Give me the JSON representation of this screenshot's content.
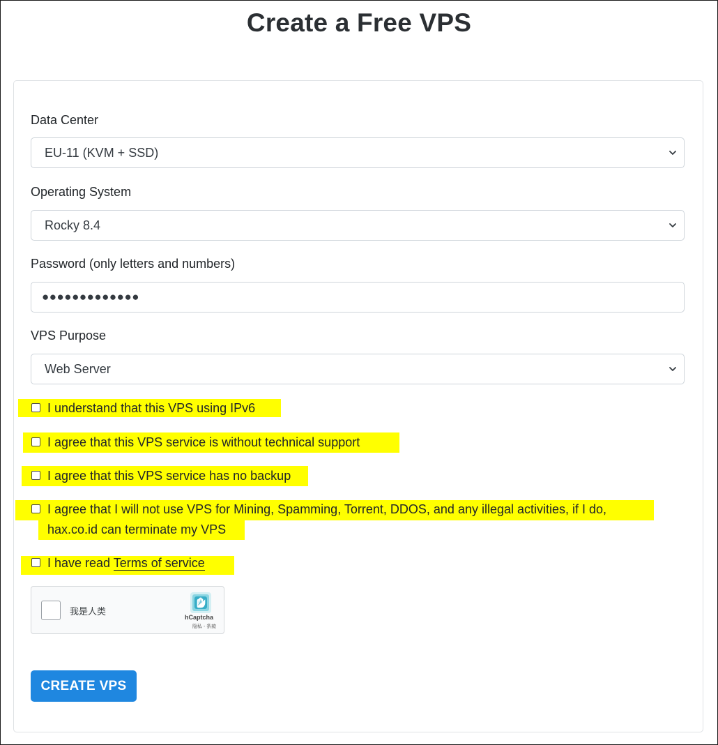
{
  "page": {
    "title": "Create a Free VPS"
  },
  "form": {
    "data_center": {
      "label": "Data Center",
      "selected": "EU-11 (KVM + SSD)"
    },
    "operating_system": {
      "label": "Operating System",
      "selected": "Rocky 8.4"
    },
    "password": {
      "label": "Password (only letters and numbers)",
      "masked_value": "●●●●●●●●●●●●●"
    },
    "purpose": {
      "label": "VPS Purpose",
      "selected": "Web Server"
    },
    "checkboxes": [
      {
        "text": "I understand that this VPS using IPv6",
        "checked": false
      },
      {
        "text": "I agree that this VPS service is without technical support",
        "checked": false
      },
      {
        "text": "I agree that this VPS service has no backup",
        "checked": false
      },
      {
        "text_line1": "I agree that I will not use VPS for Mining, Spamming, Torrent, DDOS, and any illegal activities, if I do,",
        "text_line2": "hax.co.id can terminate my VPS",
        "checked": false
      },
      {
        "text_prefix": "I have read ",
        "link_text": "Terms of service",
        "checked": false
      }
    ],
    "captcha": {
      "label": "我是人类",
      "brand": "hCaptcha",
      "links": "隐私 - 条款"
    },
    "submit_label": "CREATE VPS"
  },
  "colors": {
    "highlight": "#ffff00",
    "button": "#1f87e0",
    "title": "#2b2f33"
  },
  "icons": {
    "select_arrow": "chevron-down-icon",
    "captcha_logo": "hcaptcha-logo-icon"
  }
}
